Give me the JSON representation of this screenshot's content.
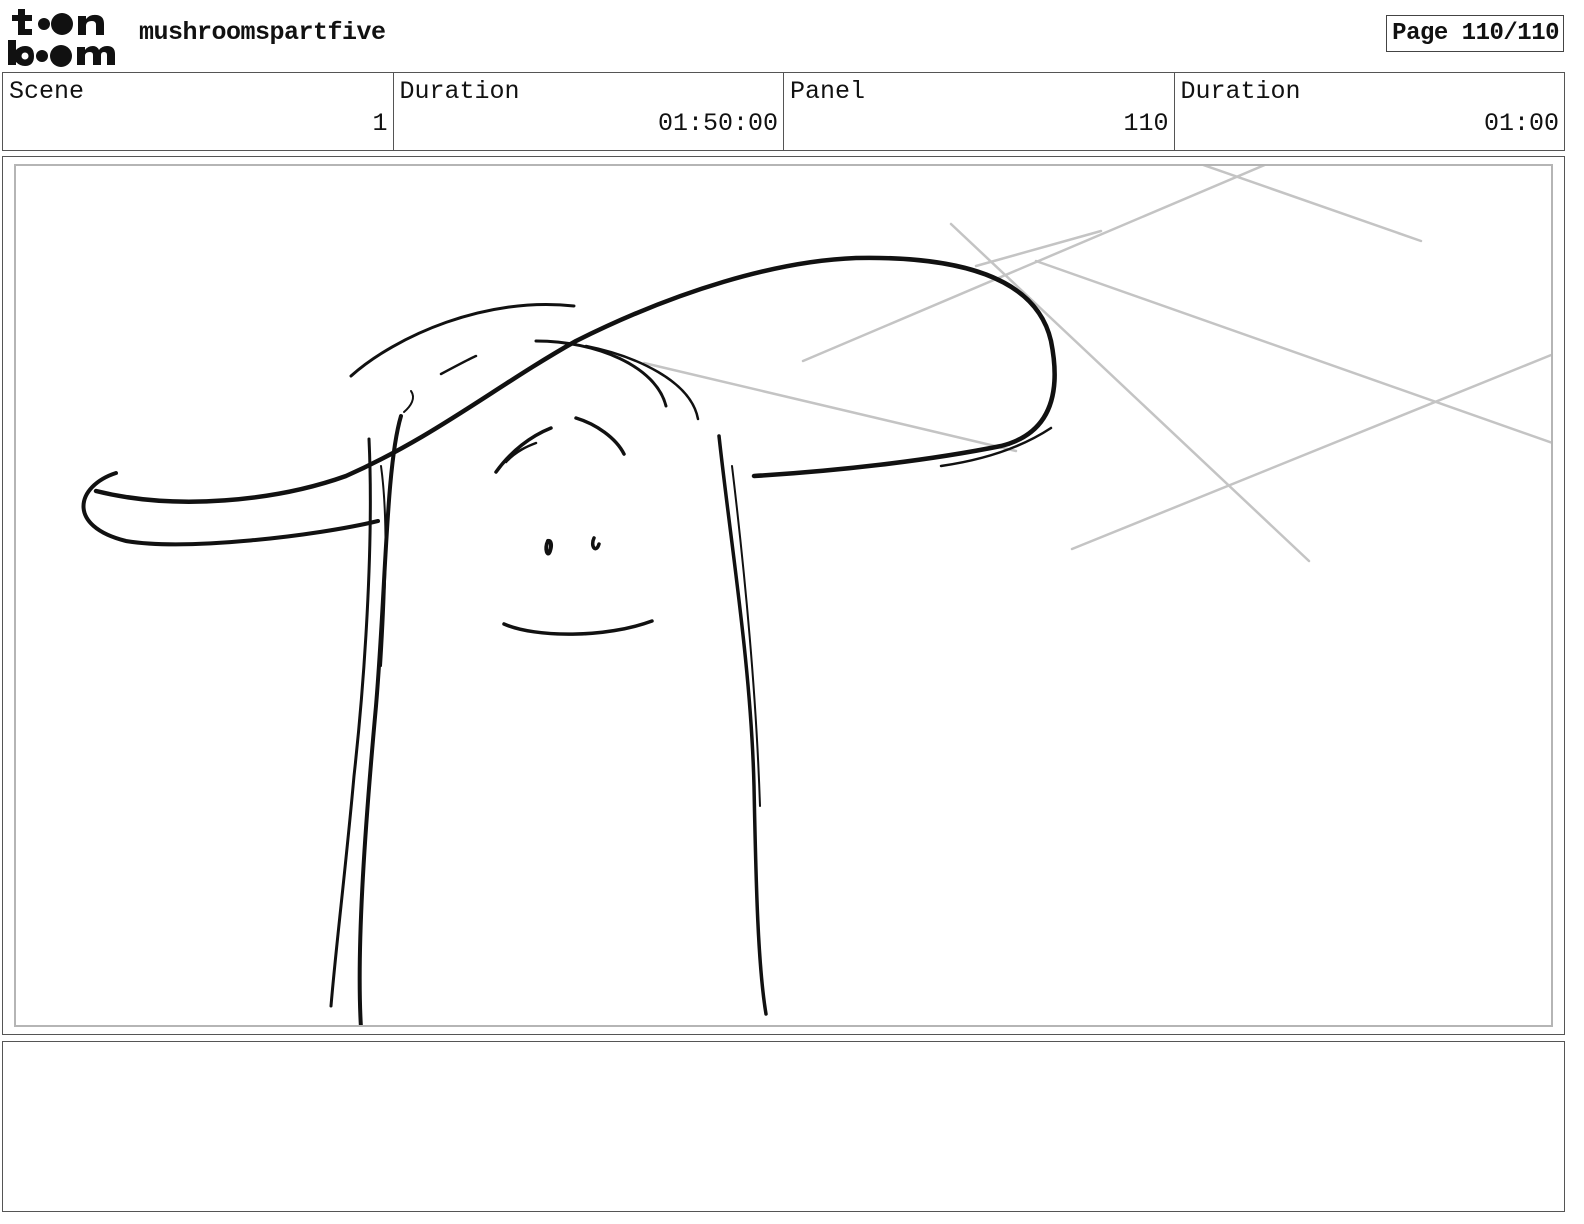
{
  "header": {
    "logo_text": "toon boom",
    "project_title": "mushroomspartfive",
    "page_indicator": "Page 110/110"
  },
  "info": {
    "scene_label": "Scene",
    "scene_value": "1",
    "scene_duration_label": "Duration",
    "scene_duration_value": "01:50:00",
    "panel_label": "Panel",
    "panel_value": "110",
    "panel_duration_label": "Duration",
    "panel_duration_value": "01:00"
  },
  "colors": {
    "sketch_stroke": "#111111",
    "guide_lines": "#c4c4c4",
    "frame_border": "#b5b5b5"
  }
}
